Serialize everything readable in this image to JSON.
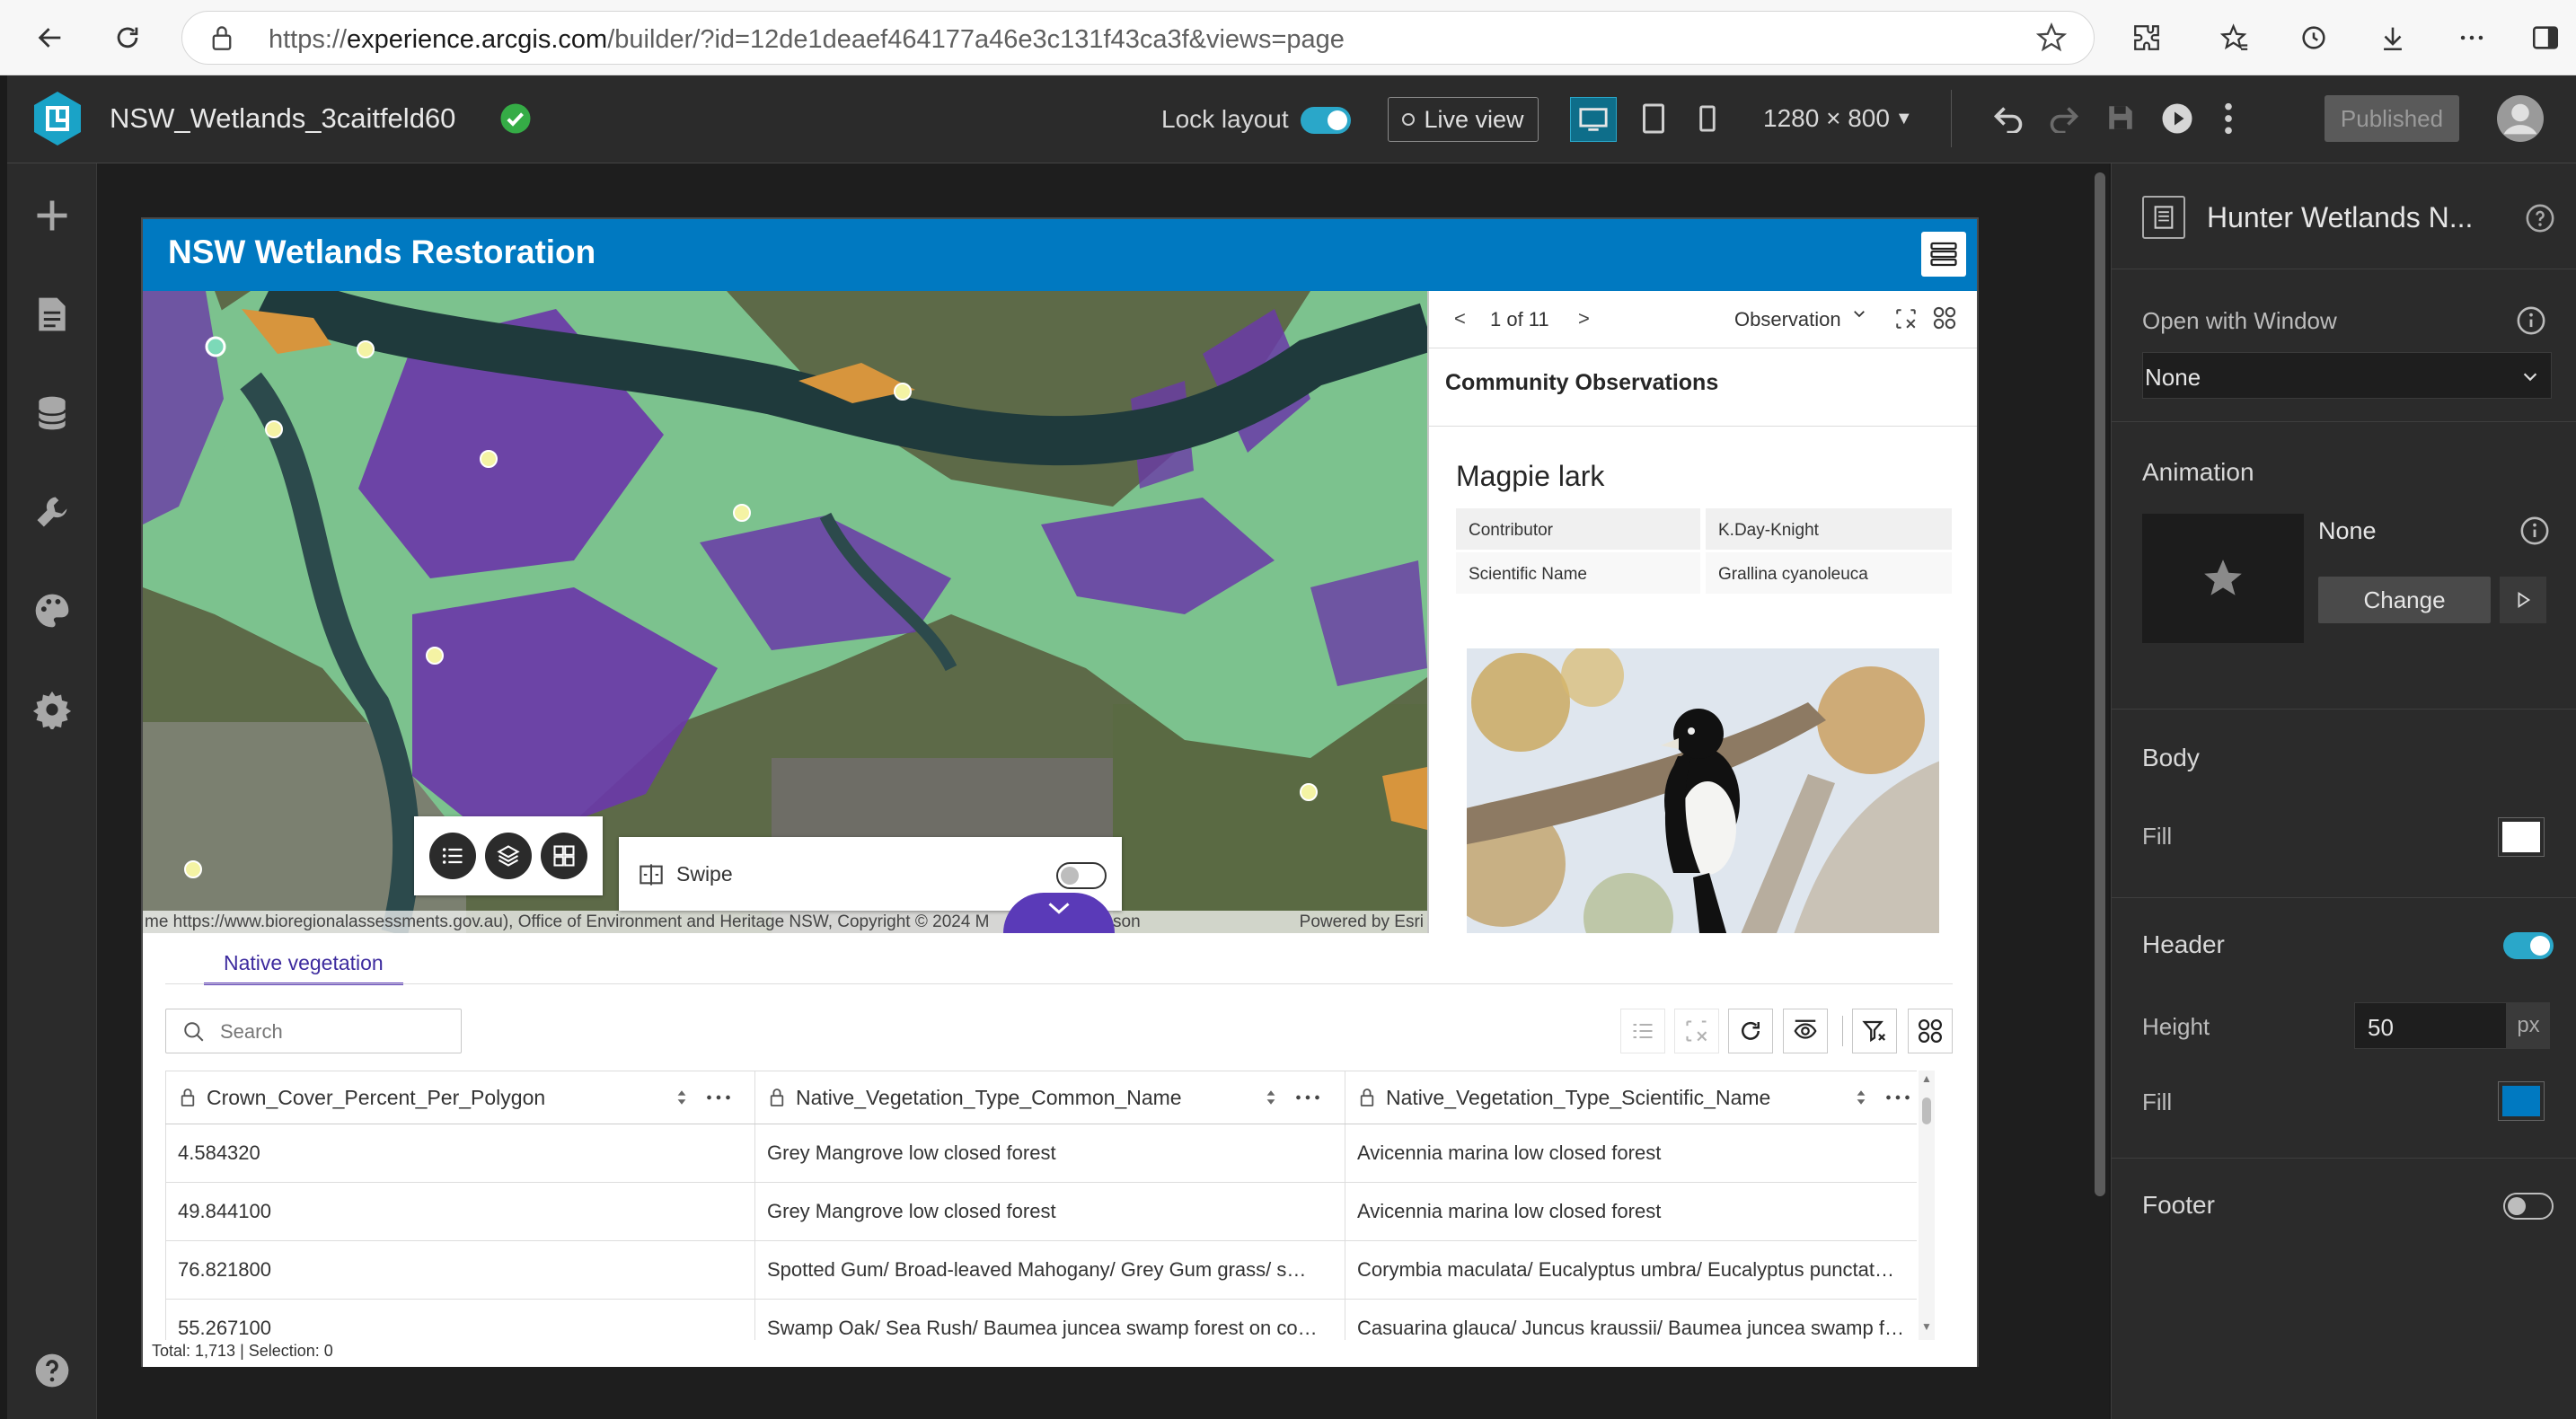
{
  "browser": {
    "url_prefix": "https://",
    "url_domain": "experience.arcgis.com",
    "url_path": "/builder/?id=12de1deaef464177a46e3c131f43ca3f&views=page"
  },
  "app_header": {
    "title": "NSW_Wetlands_3caitfeld60",
    "lock_layout_label": "Lock layout",
    "lock_layout_on": true,
    "live_view_label": "Live view",
    "resolution": "1280 × 800",
    "published_label": "Published"
  },
  "page": {
    "title": "NSW Wetlands Restoration"
  },
  "map": {
    "attribution_left": "me https://www.bioregionalassessments.gov.au), Office of Environment and Heritage NSW, Copyright © 2024 M",
    "attribution_left_tail": "son",
    "attribution_right": "Powered by Esri",
    "swipe_label": "Swipe"
  },
  "popup": {
    "counter": "1 of 11",
    "prev": "<",
    "next": ">",
    "layer_select": "Observation",
    "heading": "Community Observations",
    "name": "Magpie lark",
    "attributes": [
      {
        "key": "Contributor",
        "value": "K.Day-Knight"
      },
      {
        "key": "Scientific Name",
        "value": "Grallina cyanoleuca"
      }
    ]
  },
  "table": {
    "tab_label": "Native vegetation",
    "search_placeholder": "Search",
    "columns": [
      "Crown_Cover_Percent_Per_Polygon",
      "Native_Vegetation_Type_Common_Name",
      "Native_Vegetation_Type_Scientific_Name"
    ],
    "rows": [
      [
        "4.584320",
        "Grey Mangrove low closed forest",
        "Avicennia marina low closed forest"
      ],
      [
        "49.844100",
        "Grey Mangrove low closed forest",
        "Avicennia marina low closed forest"
      ],
      [
        "76.821800",
        "Spotted Gum/ Broad-leaved Mahogany/ Grey Gum grass/ s…",
        "Corymbia maculata/ Eucalyptus umbra/ Eucalyptus punctat…"
      ],
      [
        "55.267100",
        "Swamp Oak/ Sea Rush/ Baumea juncea swamp forest on co…",
        "Casuarina glauca/ Juncus kraussii/ Baumea juncea swamp f…"
      ]
    ],
    "total": "Total: 1,713 | Selection: 0"
  },
  "right_panel": {
    "title": "Hunter Wetlands N...",
    "open_with_window_label": "Open with Window",
    "open_with_window_value": "None",
    "animation_label": "Animation",
    "animation_value": "None",
    "change_label": "Change",
    "body_label": "Body",
    "fill_label": "Fill",
    "body_fill_color": "#ffffff",
    "header_label": "Header",
    "header_on": true,
    "height_label": "Height",
    "height_value": "50",
    "height_unit": "px",
    "header_fill_label": "Fill",
    "header_fill_color": "#0079c1",
    "footer_label": "Footer",
    "footer_on": false
  },
  "colors": {
    "brand": "#0079c1",
    "accent": "#2aa7c9",
    "vegetation_green": "#7cc28e",
    "vegetation_purple": "#6a3aa8"
  }
}
